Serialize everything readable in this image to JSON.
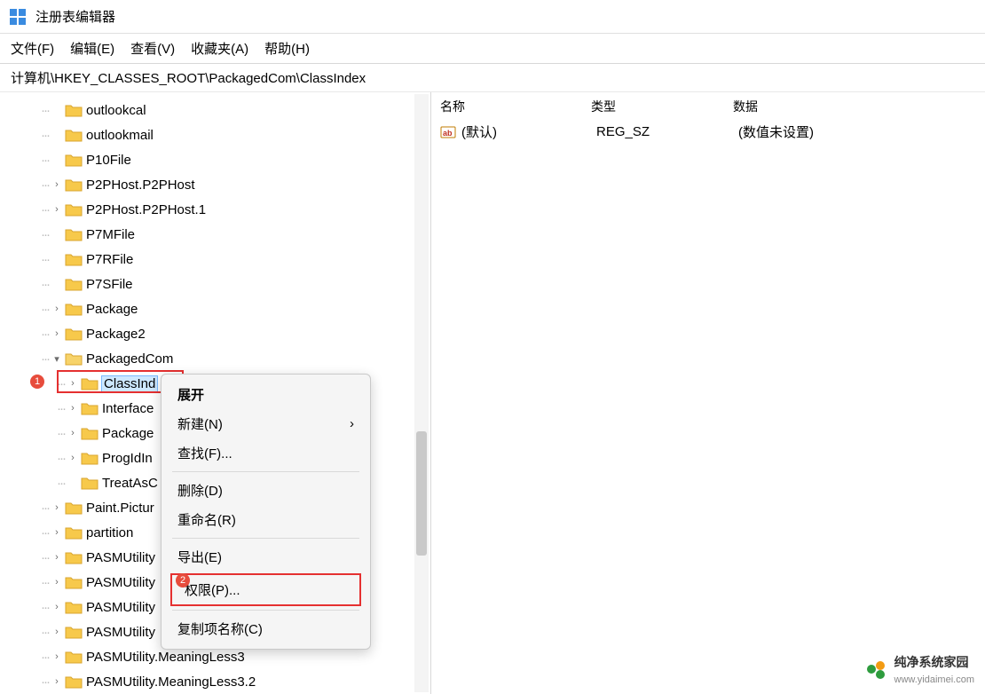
{
  "app": {
    "title": "注册表编辑器"
  },
  "menu": [
    {
      "label": "文件(F)"
    },
    {
      "label": "编辑(E)"
    },
    {
      "label": "查看(V)"
    },
    {
      "label": "收藏夹(A)"
    },
    {
      "label": "帮助(H)"
    }
  ],
  "address": "计算机\\HKEY_CLASSES_ROOT\\PackagedCom\\ClassIndex",
  "tree": {
    "items": [
      {
        "label": "outlookcal",
        "exp": false,
        "indent": 1
      },
      {
        "label": "outlookmail",
        "exp": false,
        "indent": 1
      },
      {
        "label": "P10File",
        "exp": false,
        "indent": 1
      },
      {
        "label": "P2PHost.P2PHost",
        "exp": true,
        "indent": 1
      },
      {
        "label": "P2PHost.P2PHost.1",
        "exp": true,
        "indent": 1
      },
      {
        "label": "P7MFile",
        "exp": false,
        "indent": 1
      },
      {
        "label": "P7RFile",
        "exp": false,
        "indent": 1
      },
      {
        "label": "P7SFile",
        "exp": false,
        "indent": 1
      },
      {
        "label": "Package",
        "exp": true,
        "indent": 1
      },
      {
        "label": "Package2",
        "exp": true,
        "indent": 1
      },
      {
        "label": "PackagedCom",
        "exp": true,
        "indent": 1,
        "open": true
      },
      {
        "label": "ClassInd",
        "exp": true,
        "indent": 2,
        "selected": true,
        "badge": "1"
      },
      {
        "label": "Interface",
        "exp": true,
        "indent": 2
      },
      {
        "label": "Package",
        "exp": true,
        "indent": 2
      },
      {
        "label": "ProgIdIn",
        "exp": true,
        "indent": 2
      },
      {
        "label": "TreatAsC",
        "exp": false,
        "indent": 2
      },
      {
        "label": "Paint.Pictur",
        "exp": true,
        "indent": 1
      },
      {
        "label": "partition",
        "exp": true,
        "indent": 1
      },
      {
        "label": "PASMUtility",
        "exp": true,
        "indent": 1
      },
      {
        "label": "PASMUtility",
        "exp": true,
        "indent": 1
      },
      {
        "label": "PASMUtility",
        "exp": true,
        "indent": 1
      },
      {
        "label": "PASMUtility",
        "exp": true,
        "indent": 1
      },
      {
        "label": "PASMUtility.MeaningLess3",
        "exp": true,
        "indent": 1
      },
      {
        "label": "PASMUtility.MeaningLess3.2",
        "exp": true,
        "indent": 1
      }
    ]
  },
  "context_menu": {
    "items": [
      {
        "label": "展开",
        "bold": true
      },
      {
        "label": "新建(N)",
        "arrow": true
      },
      {
        "label": "查找(F)..."
      },
      {
        "sep": true
      },
      {
        "label": "删除(D)"
      },
      {
        "label": "重命名(R)"
      },
      {
        "sep": true
      },
      {
        "label": "导出(E)"
      },
      {
        "label": "权限(P)...",
        "highlight": true,
        "badge": "2"
      },
      {
        "sep": true
      },
      {
        "label": "复制项名称(C)"
      }
    ]
  },
  "list": {
    "headers": {
      "name": "名称",
      "type": "类型",
      "data": "数据"
    },
    "rows": [
      {
        "name": "(默认)",
        "type": "REG_SZ",
        "data": "(数值未设置)"
      }
    ]
  },
  "watermark": {
    "title": "纯净系统家园",
    "url": "www.yidaimei.com"
  }
}
